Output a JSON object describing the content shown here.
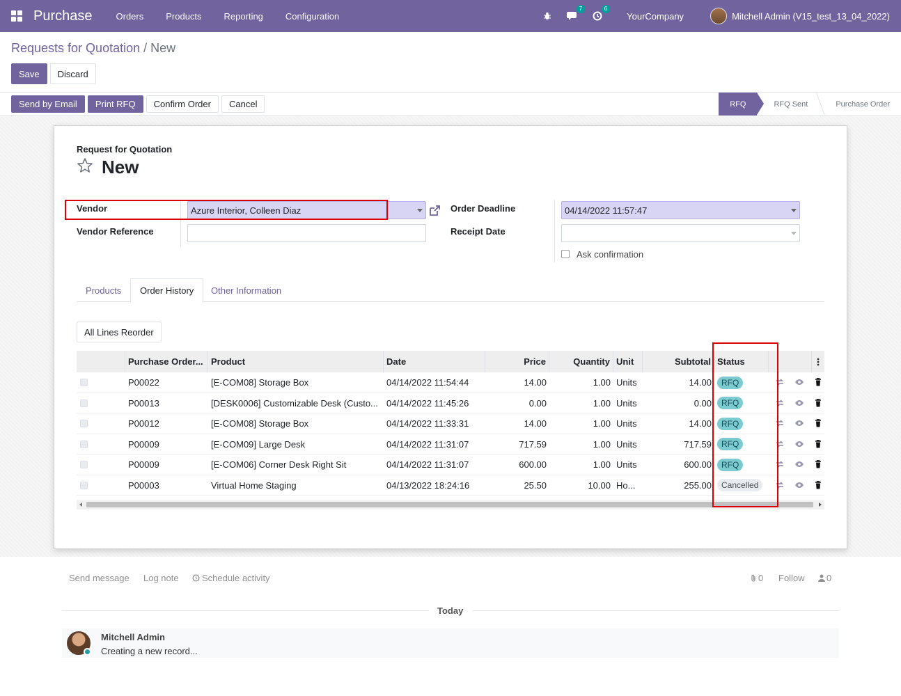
{
  "navbar": {
    "app_name": "Purchase",
    "menu": [
      "Orders",
      "Products",
      "Reporting",
      "Configuration"
    ],
    "messages_count": "7",
    "activities_count": "6",
    "company": "YourCompany",
    "user": "Mitchell Admin (V15_test_13_04_2022)"
  },
  "breadcrumb": {
    "parent": "Requests for Quotation",
    "separator": "/",
    "current": "New"
  },
  "control": {
    "save_label": "Save",
    "discard_label": "Discard"
  },
  "actions": {
    "send_email": "Send by Email",
    "print_rfq": "Print RFQ",
    "confirm_order": "Confirm Order",
    "cancel": "Cancel"
  },
  "statusbar": {
    "stages": [
      "RFQ",
      "RFQ Sent",
      "Purchase Order"
    ],
    "active": "RFQ"
  },
  "form": {
    "doc_type": "Request for Quotation",
    "title": "New",
    "vendor_label": "Vendor",
    "vendor_value": "Azure Interior, Colleen Diaz",
    "vendor_ref_label": "Vendor Reference",
    "vendor_ref_value": "",
    "order_deadline_label": "Order Deadline",
    "order_deadline_value": "04/14/2022 11:57:47",
    "receipt_date_label": "Receipt Date",
    "receipt_date_value": "",
    "ask_confirmation_label": "Ask confirmation"
  },
  "tabs": [
    "Products",
    "Order History",
    "Other Information"
  ],
  "active_tab": "Order History",
  "reorder_button": "All Lines Reorder",
  "table": {
    "columns": [
      "Purchase Order...",
      "Product",
      "Date",
      "Price",
      "Quantity",
      "Unit",
      "Subtotal",
      "Status"
    ],
    "rows": [
      {
        "po": "P00022",
        "product": "[E-COM08] Storage Box",
        "date": "04/14/2022 11:54:44",
        "price": "14.00",
        "qty": "1.00",
        "unit": "Units",
        "subtotal": "14.00",
        "status": "RFQ"
      },
      {
        "po": "P00013",
        "product": "[DESK0006] Customizable Desk (Custo...",
        "date": "04/14/2022 11:45:26",
        "price": "0.00",
        "qty": "1.00",
        "unit": "Units",
        "subtotal": "0.00",
        "status": "RFQ"
      },
      {
        "po": "P00012",
        "product": "[E-COM08] Storage Box",
        "date": "04/14/2022 11:33:31",
        "price": "14.00",
        "qty": "1.00",
        "unit": "Units",
        "subtotal": "14.00",
        "status": "RFQ"
      },
      {
        "po": "P00009",
        "product": "[E-COM09] Large Desk",
        "date": "04/14/2022 11:31:07",
        "price": "717.59",
        "qty": "1.00",
        "unit": "Units",
        "subtotal": "717.59",
        "status": "RFQ"
      },
      {
        "po": "P00009",
        "product": "[E-COM06] Corner Desk Right Sit",
        "date": "04/14/2022 11:31:07",
        "price": "600.00",
        "qty": "1.00",
        "unit": "Units",
        "subtotal": "600.00",
        "status": "RFQ"
      },
      {
        "po": "P00003",
        "product": "Virtual Home Staging",
        "date": "04/13/2022 18:24:16",
        "price": "25.50",
        "qty": "10.00",
        "unit": "Ho...",
        "subtotal": "255.00",
        "status": "Cancelled"
      }
    ]
  },
  "chatter": {
    "send_message": "Send message",
    "log_note": "Log note",
    "schedule_activity": "Schedule activity",
    "attachments_count": "0",
    "follow": "Follow",
    "followers_count": "0",
    "today": "Today",
    "message_author": "Mitchell Admin",
    "message_body": "Creating a new record..."
  },
  "colors": {
    "brand": "#71639e",
    "rfq_badge": "#7ccbd1",
    "highlight": "#dd0000"
  }
}
